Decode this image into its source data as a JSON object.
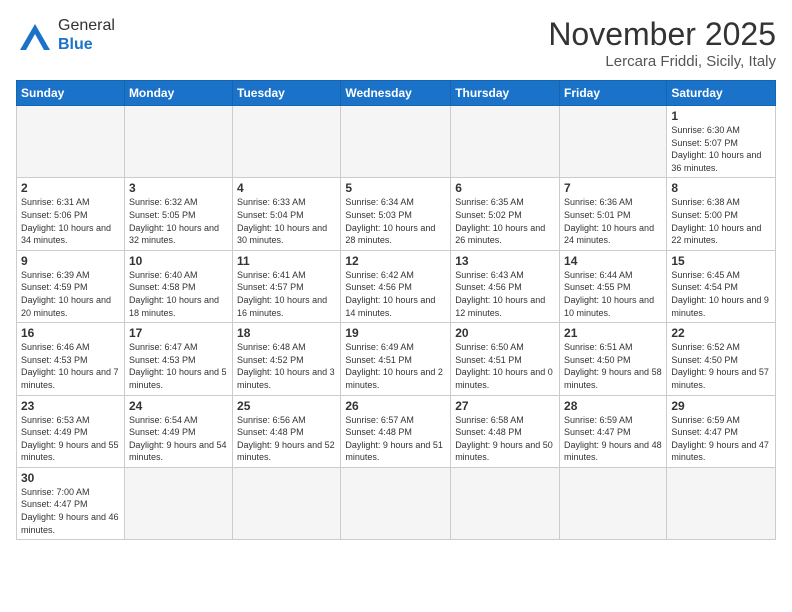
{
  "header": {
    "logo_general": "General",
    "logo_blue": "Blue",
    "month_title": "November 2025",
    "subtitle": "Lercara Friddi, Sicily, Italy"
  },
  "weekdays": [
    "Sunday",
    "Monday",
    "Tuesday",
    "Wednesday",
    "Thursday",
    "Friday",
    "Saturday"
  ],
  "weeks": [
    [
      {
        "day": "",
        "info": ""
      },
      {
        "day": "",
        "info": ""
      },
      {
        "day": "",
        "info": ""
      },
      {
        "day": "",
        "info": ""
      },
      {
        "day": "",
        "info": ""
      },
      {
        "day": "",
        "info": ""
      },
      {
        "day": "1",
        "info": "Sunrise: 6:30 AM\nSunset: 5:07 PM\nDaylight: 10 hours\nand 36 minutes."
      }
    ],
    [
      {
        "day": "2",
        "info": "Sunrise: 6:31 AM\nSunset: 5:06 PM\nDaylight: 10 hours\nand 34 minutes."
      },
      {
        "day": "3",
        "info": "Sunrise: 6:32 AM\nSunset: 5:05 PM\nDaylight: 10 hours\nand 32 minutes."
      },
      {
        "day": "4",
        "info": "Sunrise: 6:33 AM\nSunset: 5:04 PM\nDaylight: 10 hours\nand 30 minutes."
      },
      {
        "day": "5",
        "info": "Sunrise: 6:34 AM\nSunset: 5:03 PM\nDaylight: 10 hours\nand 28 minutes."
      },
      {
        "day": "6",
        "info": "Sunrise: 6:35 AM\nSunset: 5:02 PM\nDaylight: 10 hours\nand 26 minutes."
      },
      {
        "day": "7",
        "info": "Sunrise: 6:36 AM\nSunset: 5:01 PM\nDaylight: 10 hours\nand 24 minutes."
      },
      {
        "day": "8",
        "info": "Sunrise: 6:38 AM\nSunset: 5:00 PM\nDaylight: 10 hours\nand 22 minutes."
      }
    ],
    [
      {
        "day": "9",
        "info": "Sunrise: 6:39 AM\nSunset: 4:59 PM\nDaylight: 10 hours\nand 20 minutes."
      },
      {
        "day": "10",
        "info": "Sunrise: 6:40 AM\nSunset: 4:58 PM\nDaylight: 10 hours\nand 18 minutes."
      },
      {
        "day": "11",
        "info": "Sunrise: 6:41 AM\nSunset: 4:57 PM\nDaylight: 10 hours\nand 16 minutes."
      },
      {
        "day": "12",
        "info": "Sunrise: 6:42 AM\nSunset: 4:56 PM\nDaylight: 10 hours\nand 14 minutes."
      },
      {
        "day": "13",
        "info": "Sunrise: 6:43 AM\nSunset: 4:56 PM\nDaylight: 10 hours\nand 12 minutes."
      },
      {
        "day": "14",
        "info": "Sunrise: 6:44 AM\nSunset: 4:55 PM\nDaylight: 10 hours\nand 10 minutes."
      },
      {
        "day": "15",
        "info": "Sunrise: 6:45 AM\nSunset: 4:54 PM\nDaylight: 10 hours\nand 9 minutes."
      }
    ],
    [
      {
        "day": "16",
        "info": "Sunrise: 6:46 AM\nSunset: 4:53 PM\nDaylight: 10 hours\nand 7 minutes."
      },
      {
        "day": "17",
        "info": "Sunrise: 6:47 AM\nSunset: 4:53 PM\nDaylight: 10 hours\nand 5 minutes."
      },
      {
        "day": "18",
        "info": "Sunrise: 6:48 AM\nSunset: 4:52 PM\nDaylight: 10 hours\nand 3 minutes."
      },
      {
        "day": "19",
        "info": "Sunrise: 6:49 AM\nSunset: 4:51 PM\nDaylight: 10 hours\nand 2 minutes."
      },
      {
        "day": "20",
        "info": "Sunrise: 6:50 AM\nSunset: 4:51 PM\nDaylight: 10 hours\nand 0 minutes."
      },
      {
        "day": "21",
        "info": "Sunrise: 6:51 AM\nSunset: 4:50 PM\nDaylight: 9 hours\nand 58 minutes."
      },
      {
        "day": "22",
        "info": "Sunrise: 6:52 AM\nSunset: 4:50 PM\nDaylight: 9 hours\nand 57 minutes."
      }
    ],
    [
      {
        "day": "23",
        "info": "Sunrise: 6:53 AM\nSunset: 4:49 PM\nDaylight: 9 hours\nand 55 minutes."
      },
      {
        "day": "24",
        "info": "Sunrise: 6:54 AM\nSunset: 4:49 PM\nDaylight: 9 hours\nand 54 minutes."
      },
      {
        "day": "25",
        "info": "Sunrise: 6:56 AM\nSunset: 4:48 PM\nDaylight: 9 hours\nand 52 minutes."
      },
      {
        "day": "26",
        "info": "Sunrise: 6:57 AM\nSunset: 4:48 PM\nDaylight: 9 hours\nand 51 minutes."
      },
      {
        "day": "27",
        "info": "Sunrise: 6:58 AM\nSunset: 4:48 PM\nDaylight: 9 hours\nand 50 minutes."
      },
      {
        "day": "28",
        "info": "Sunrise: 6:59 AM\nSunset: 4:47 PM\nDaylight: 9 hours\nand 48 minutes."
      },
      {
        "day": "29",
        "info": "Sunrise: 6:59 AM\nSunset: 4:47 PM\nDaylight: 9 hours\nand 47 minutes."
      }
    ],
    [
      {
        "day": "30",
        "info": "Sunrise: 7:00 AM\nSunset: 4:47 PM\nDaylight: 9 hours\nand 46 minutes."
      },
      {
        "day": "",
        "info": ""
      },
      {
        "day": "",
        "info": ""
      },
      {
        "day": "",
        "info": ""
      },
      {
        "day": "",
        "info": ""
      },
      {
        "day": "",
        "info": ""
      },
      {
        "day": "",
        "info": ""
      }
    ]
  ]
}
